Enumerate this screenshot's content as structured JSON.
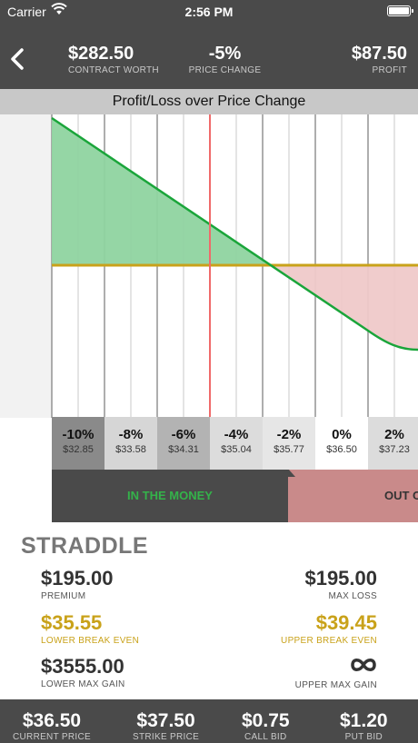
{
  "status": {
    "carrier": "Carrier",
    "time": "2:56 PM"
  },
  "header": {
    "contract_worth": {
      "value": "$282.50",
      "label": "CONTRACT WORTH"
    },
    "price_change": {
      "value": "-5%",
      "label": "PRICE CHANGE"
    },
    "profit": {
      "value": "$87.50",
      "label": "PROFIT"
    },
    "back_icon": "chevron-left-icon"
  },
  "chart": {
    "title": "Profit/Loss over Price Change",
    "cells": [
      {
        "pct": "-10%",
        "price": "$32.85"
      },
      {
        "pct": "-8%",
        "price": "$33.58"
      },
      {
        "pct": "-6%",
        "price": "$34.31"
      },
      {
        "pct": "-4%",
        "price": "$35.04"
      },
      {
        "pct": "-2%",
        "price": "$35.77"
      },
      {
        "pct": "0%",
        "price": "$36.50"
      },
      {
        "pct": "2%",
        "price": "$37.23"
      }
    ],
    "in_the_money": "IN THE MONEY",
    "out_of_the_money": "OUT OF THE MONEY",
    "colors": {
      "profit_fill": "#8fd4a0",
      "loss_fill": "#efc9c9",
      "payoff_line": "#1aa53a",
      "breakeven_line": "#c9a21a",
      "current_marker": "#f06a6a"
    }
  },
  "strategy": {
    "name": "STRADDLE",
    "premium": {
      "value": "$195.00",
      "label": "PREMIUM"
    },
    "max_loss": {
      "value": "$195.00",
      "label": "MAX LOSS"
    },
    "lower_break_even": {
      "value": "$35.55",
      "label": "LOWER BREAK EVEN"
    },
    "upper_break_even": {
      "value": "$39.45",
      "label": "UPPER BREAK EVEN"
    },
    "lower_max_gain": {
      "value": "$3555.00",
      "label": "LOWER MAX GAIN"
    },
    "upper_max_gain": {
      "value": "∞",
      "label": "UPPER MAX GAIN",
      "icon": "infinity-icon"
    }
  },
  "footer": {
    "current_price": {
      "value": "$36.50",
      "label": "CURRENT PRICE"
    },
    "strike_price": {
      "value": "$37.50",
      "label": "STRIKE PRICE"
    },
    "call_bid": {
      "value": "$0.75",
      "label": "CALL BID"
    },
    "put_bid": {
      "value": "$1.20",
      "label": "PUT BID"
    }
  }
}
